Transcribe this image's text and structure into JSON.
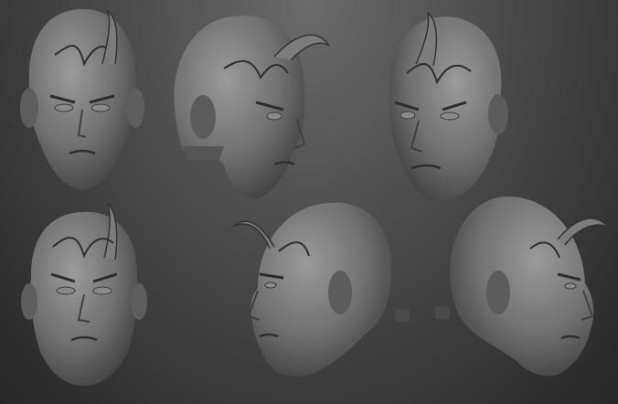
{
  "scene": {
    "subject": "sculpted-head-turnaround",
    "colors": {
      "bg_top": "#6a6a6a",
      "bg_bottom": "#262626",
      "clay_light": "#8d8d8d",
      "clay_mid": "#6f6f6f",
      "clay_dark": "#3a3a3a",
      "crease": "#2c2c2c"
    },
    "views": [
      {
        "id": "front-view",
        "icon": "head-front-icon"
      },
      {
        "id": "three-quarter-right-view",
        "icon": "head-three-quarter-icon"
      },
      {
        "id": "three-quarter-left-view",
        "icon": "head-three-quarter-icon"
      },
      {
        "id": "front-low-view",
        "icon": "head-front-low-icon"
      },
      {
        "id": "profile-left-view",
        "icon": "head-profile-icon"
      },
      {
        "id": "profile-right-view",
        "icon": "head-profile-icon"
      }
    ]
  }
}
